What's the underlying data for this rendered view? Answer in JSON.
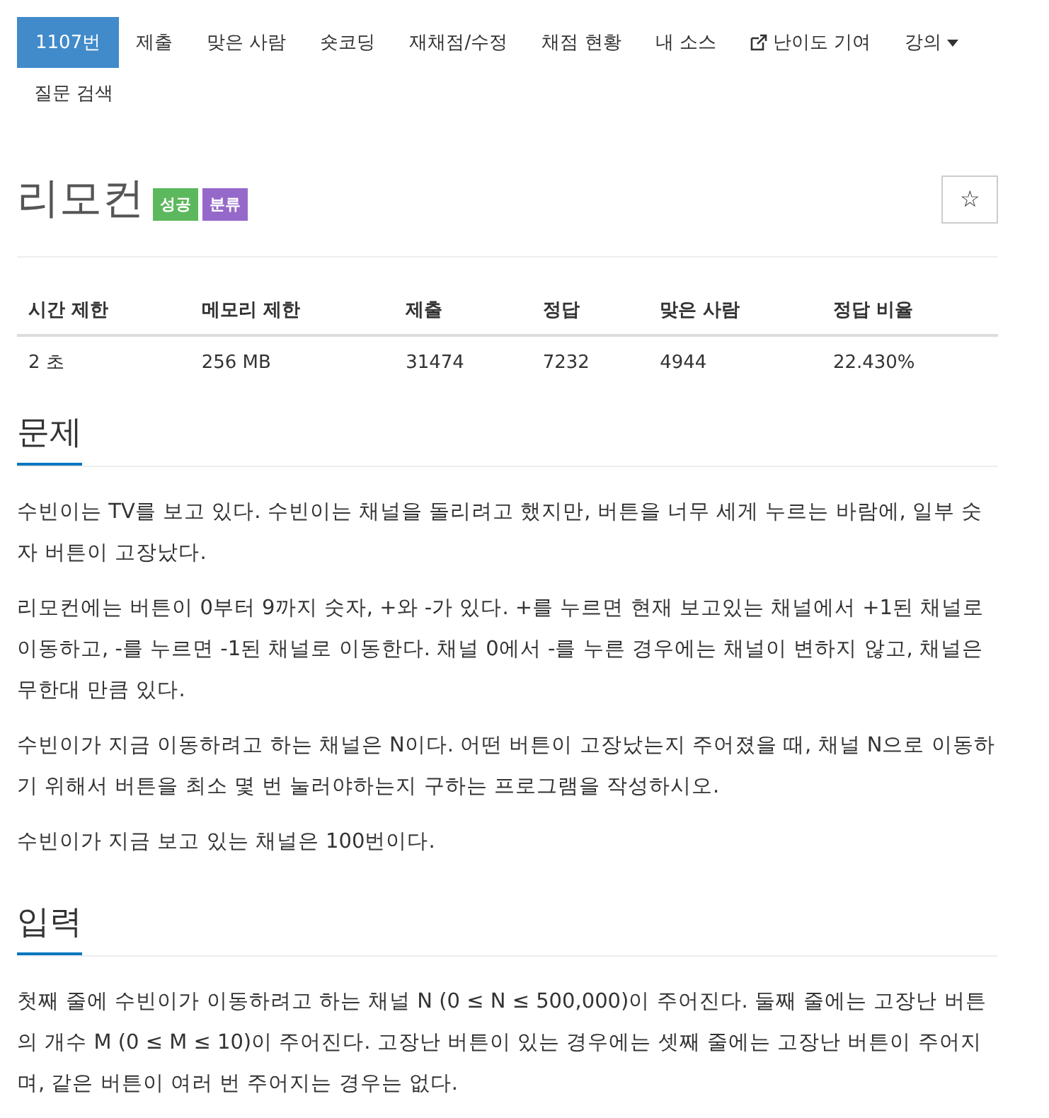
{
  "nav": [
    {
      "label": "1107번",
      "selected": true,
      "kind": "link"
    },
    {
      "label": "제출",
      "selected": false,
      "kind": "link"
    },
    {
      "label": "맞은 사람",
      "selected": false,
      "kind": "link"
    },
    {
      "label": "숏코딩",
      "selected": false,
      "kind": "link"
    },
    {
      "label": "재채점/수정",
      "selected": false,
      "kind": "link"
    },
    {
      "label": "채점 현황",
      "selected": false,
      "kind": "link"
    },
    {
      "label": "내 소스",
      "selected": false,
      "kind": "link"
    },
    {
      "label": "난이도 기여",
      "selected": false,
      "kind": "external"
    },
    {
      "label": "강의",
      "selected": false,
      "kind": "dropdown"
    },
    {
      "label": "질문 검색",
      "selected": false,
      "kind": "link"
    }
  ],
  "title": "리모컨",
  "labels": [
    {
      "text": "성공",
      "color": "#5cb85c"
    },
    {
      "text": "분류",
      "color": "#9569c9"
    }
  ],
  "star_button": {
    "glyph": "☆"
  },
  "stats": {
    "columns": [
      "시간 제한",
      "메모리 제한",
      "제출",
      "정답",
      "맞은 사람",
      "정답 비율"
    ],
    "row": [
      "2 초",
      "256 MB",
      "31474",
      "7232",
      "4944",
      "22.430%"
    ]
  },
  "sections": [
    {
      "heading": "문제",
      "paragraphs": [
        "수빈이는 TV를 보고 있다. 수빈이는 채널을 돌리려고 했지만, 버튼을 너무 세게 누르는 바람에, 일부 숫자 버튼이 고장났다.",
        "리모컨에는 버튼이 0부터 9까지 숫자, +와 -가 있다. +를 누르면 현재 보고있는 채널에서 +1된 채널로 이동하고, -를 누르면 -1된 채널로 이동한다. 채널 0에서 -를 누른 경우에는 채널이 변하지 않고, 채널은 무한대 만큼 있다.",
        "수빈이가 지금 이동하려고 하는 채널은 N이다. 어떤 버튼이 고장났는지 주어졌을 때, 채널 N으로 이동하기 위해서 버튼을 최소 몇 번 눌러야하는지 구하는 프로그램을 작성하시오.",
        "수빈이가 지금 보고 있는 채널은 100번이다."
      ]
    },
    {
      "heading": "입력",
      "paragraphs": [
        "첫째 줄에 수빈이가 이동하려고 하는 채널 N (0 ≤ N ≤ 500,000)이 주어진다.  둘째 줄에는 고장난 버튼의 개수 M (0 ≤ M ≤ 10)이 주어진다. 고장난 버튼이 있는 경우에는 셋째 줄에는 고장난 버튼이 주어지며, 같은 버튼이 여러 번 주어지는 경우는 없다."
      ]
    }
  ]
}
